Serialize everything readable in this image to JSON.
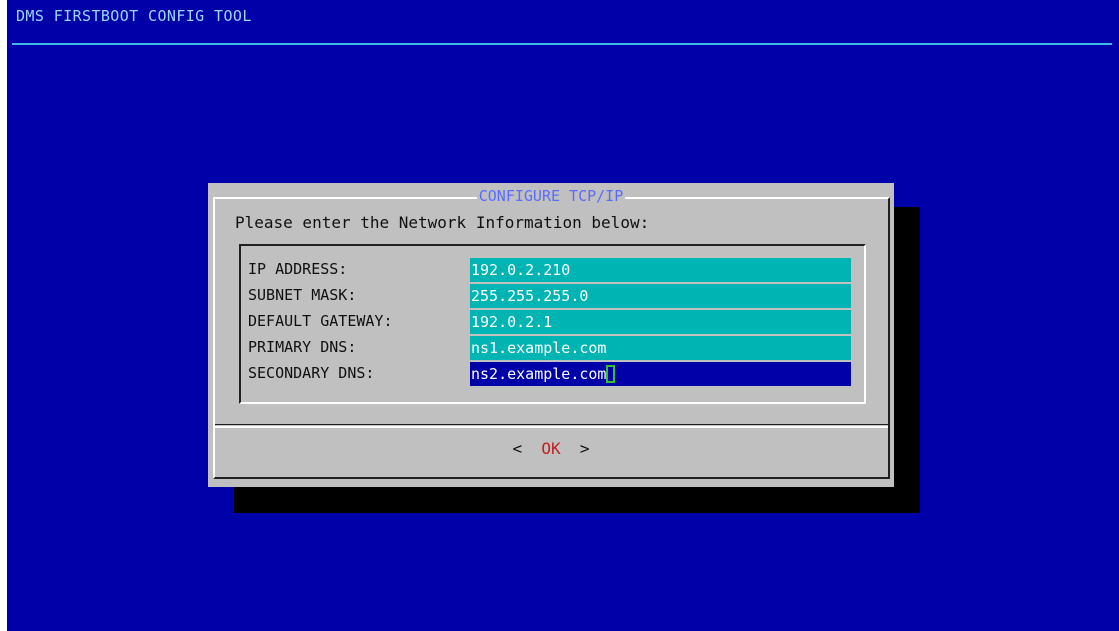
{
  "app": {
    "title": "DMS FIRSTBOOT CONFIG TOOL"
  },
  "dialog": {
    "title": "CONFIGURE TCP/IP",
    "prompt": "Please enter the Network Information below:",
    "fields": [
      {
        "label": "IP ADDRESS:",
        "value": "192.0.2.210",
        "active": false
      },
      {
        "label": "SUBNET MASK:",
        "value": "255.255.255.0",
        "active": false
      },
      {
        "label": "DEFAULT GATEWAY:",
        "value": "192.0.2.1",
        "active": false
      },
      {
        "label": "PRIMARY DNS:",
        "value": "ns1.example.com",
        "active": false
      },
      {
        "label": "SECONDARY DNS:",
        "value": "ns2.example.com",
        "active": true
      }
    ],
    "buttons": {
      "left_bracket": "<",
      "ok_label": "OK",
      "right_bracket": ">"
    }
  },
  "colors": {
    "screen_bg": "#0000a8",
    "dialog_bg": "#c0c0c0",
    "field_bg": "#00b4b4",
    "active_field_bg": "#0000a8",
    "title_text": "#9ad7ff",
    "dialog_title_text": "#5a6cff",
    "ok_text": "#c02020",
    "cursor": "#30c030"
  }
}
